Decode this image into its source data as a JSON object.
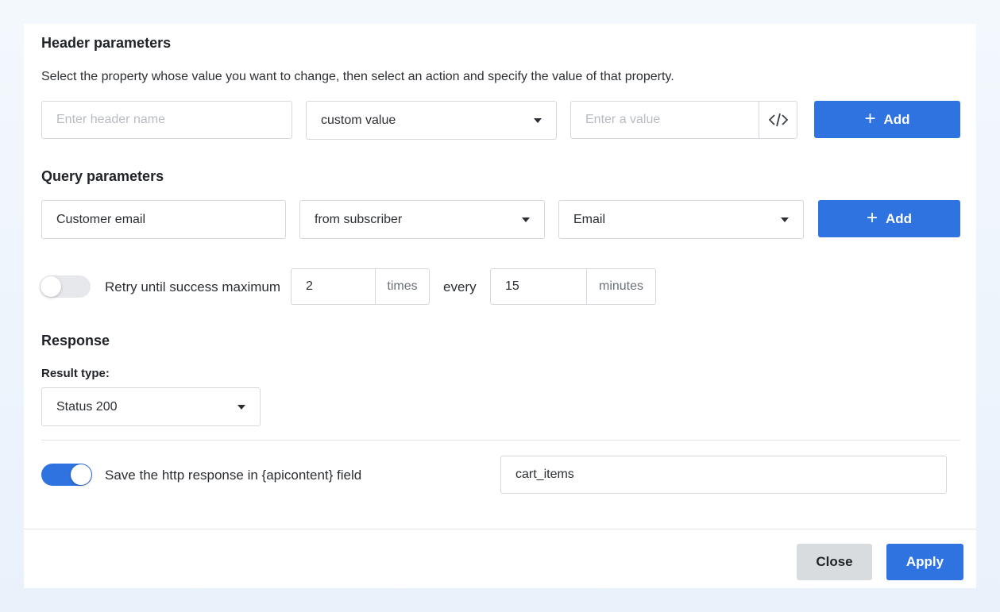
{
  "header_params": {
    "title": "Header parameters",
    "description": "Select the property whose value you want to change, then select an action and specify the value of that property.",
    "name_placeholder": "Enter header name",
    "action_value": "custom value",
    "value_placeholder": "Enter a value",
    "add_label": "Add"
  },
  "query_params": {
    "title": "Query parameters",
    "name_value": "Customer email",
    "source_value": "from subscriber",
    "field_value": "Email",
    "add_label": "Add"
  },
  "retry": {
    "enabled": false,
    "label": "Retry until success maximum",
    "times_value": "2",
    "times_unit": "times",
    "every_label": "every",
    "interval_value": "15",
    "interval_unit": "minutes"
  },
  "response": {
    "title": "Response",
    "result_type_label": "Result type:",
    "result_type_value": "Status 200",
    "save_enabled": true,
    "save_label": "Save the http response in {apicontent} field",
    "save_field_value": "cart_items"
  },
  "footer": {
    "close_label": "Close",
    "apply_label": "Apply"
  },
  "colors": {
    "primary": "#2f73e0",
    "secondary_button": "#d9dcdf"
  }
}
